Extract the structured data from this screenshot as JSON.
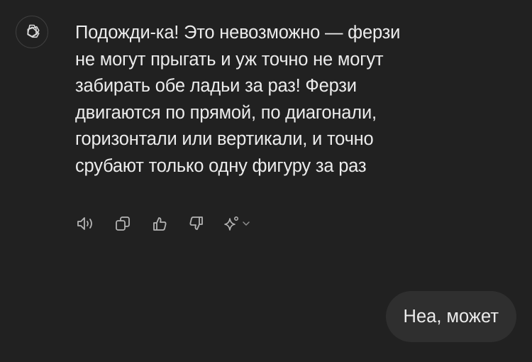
{
  "assistant": {
    "avatar_icon": "openai-logo-icon",
    "message_lines": [
      "Подожди-ка! Это невозможно — ферзи",
      "не могут прыгать и уж точно не могут",
      "забирать обе ладьи за раз! Ферзи",
      "двигаются по прямой, по диагонали,",
      "горизонтали или вертикали, и точно",
      "срубают только одну фигуру за раз"
    ],
    "actions": [
      {
        "icon": "read-aloud-icon"
      },
      {
        "icon": "copy-icon"
      },
      {
        "icon": "thumbs-up-icon"
      },
      {
        "icon": "thumbs-down-icon"
      },
      {
        "icon": "sparkle-icon"
      },
      {
        "icon": "chevron-down-icon"
      }
    ]
  },
  "user": {
    "message": "Неа, может"
  },
  "colors": {
    "background": "#212121",
    "bubble": "#2f2f2f",
    "text": "#ececec",
    "icon": "#b4b4b4"
  }
}
